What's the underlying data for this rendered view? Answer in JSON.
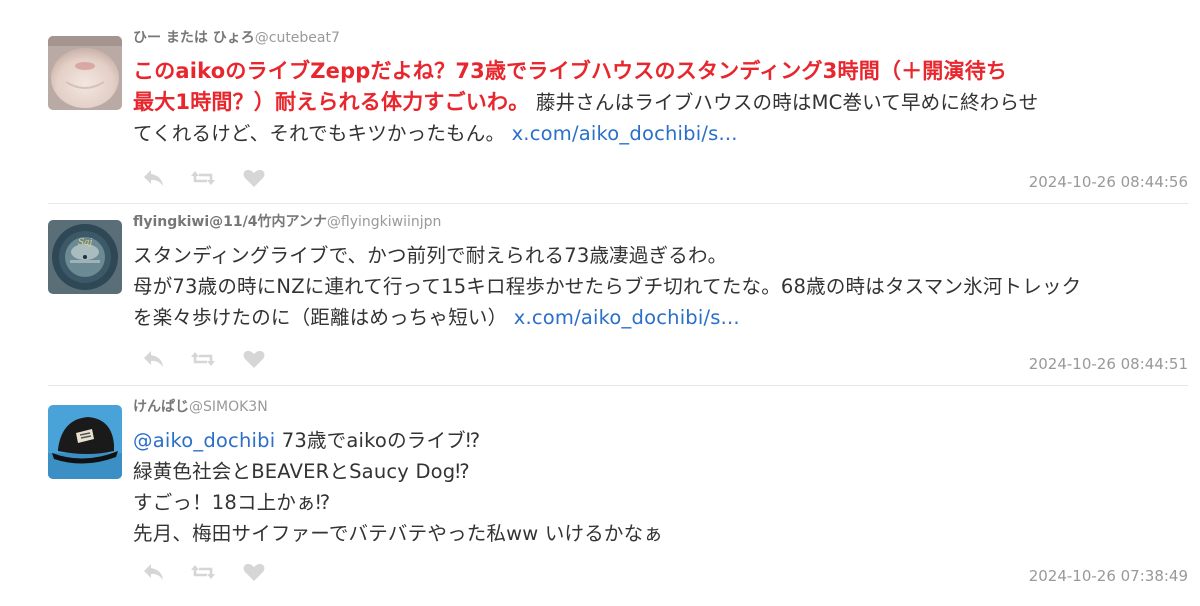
{
  "tweets": [
    {
      "display_name": "ひー または ひょろ",
      "handle": "@cutebeat7",
      "highlight_line1": "このaikoのライブZeppだよね？73歳でライブハウスのスタンディング3時間（＋開演待ち",
      "highlight_line2": "最大1時間？）耐えられる体力すごいわ。",
      "text_line2_rest": " 藤井さんはライブハウスの時はMC巻いて早めに終わらせ",
      "text_line3": "てくれるけど、それでもキツかったもん。 ",
      "link": "x.com/aiko_dochibi/s...",
      "timestamp": "2024-10-26 08:44:56",
      "avatar_icon": "pet-photo-avatar"
    },
    {
      "display_name": "flyingkiwi@11/4竹内アンナ",
      "handle": "@flyingkiwiinjpn",
      "text_line1": "スタンディングライブで、かつ前列で耐えられる73歳凄過ぎるわ。",
      "text_line2": "母が73歳の時にNZに連れて行って15キロ程歩かせたらブチ切れてたな。68歳の時はタスマン氷河トレック",
      "text_line3": "を楽々歩けたのに（距離はめっちゃ短い） ",
      "link": "x.com/aiko_dochibi/s...",
      "timestamp": "2024-10-26 08:44:51",
      "avatar_icon": "vinyl-record-avatar"
    },
    {
      "display_name": "けんぱじ",
      "handle": "@SIMOK3N",
      "mention": "@aiko_dochibi",
      "text_line1_rest": " 73歳でaikoのライブ⁉",
      "text_line2": "緑黄色社会とBEAVERとSaucy Dog⁉",
      "text_line3": "すごっ！18コ上かぁ⁉",
      "text_line4": "先月、梅田サイファーでバテバテやった私ww いけるかなぁ",
      "timestamp": "2024-10-26 07:38:49",
      "avatar_icon": "black-cap-avatar"
    }
  ],
  "actions": {
    "reply_icon": "reply-icon",
    "retweet_icon": "retweet-icon",
    "like_icon": "heart-icon"
  },
  "colors": {
    "highlight": "#e8262d",
    "link": "#2a6fc9",
    "timestamp": "#999999",
    "icon": "#d6d6d6"
  }
}
